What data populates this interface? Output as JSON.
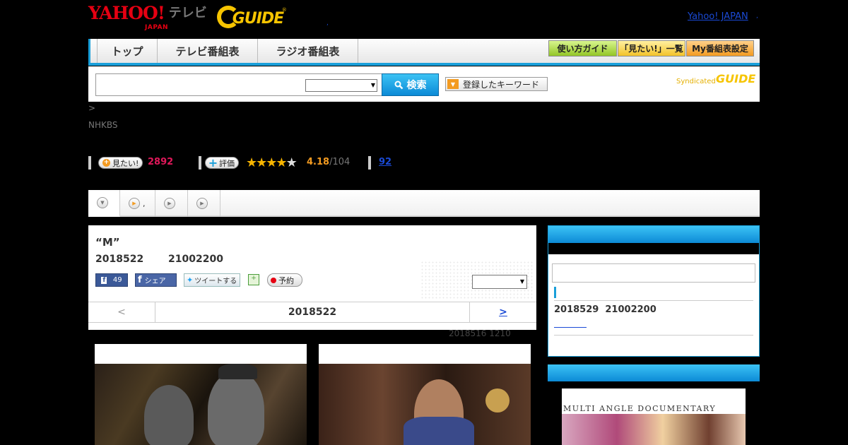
{
  "header": {
    "yahoo_logo": "YAHOO!",
    "yahoo_sub": "JAPAN",
    "tv_label": "テレビ",
    "gguide_logo": "GUIDE",
    "gguide_reg": "®",
    "dot": ",",
    "yahoo_japan_link": "Yahoo! JAPAN",
    "yahoo_japan_dot": ","
  },
  "nav": {
    "tabs": [
      {
        "label": "トップ"
      },
      {
        "label": "テレビ番組表"
      },
      {
        "label": "ラジオ番組表"
      }
    ],
    "buttons": [
      {
        "label": "使い方ガイド"
      },
      {
        "label": "「見たい!」一覧"
      },
      {
        "label": "My番組表設定"
      }
    ]
  },
  "search": {
    "query_value": "",
    "select_value": "",
    "button_label": "検索",
    "keyword_button_label": "登録したキーワード",
    "syndicated_label": "Syndicated",
    "syndicated_logo": "GUIDE"
  },
  "breadcrumb": ">",
  "channel": "NHKBS",
  "stats": {
    "mitai_label": "見たい!",
    "mitai_count": "2892",
    "rating_label": "評価",
    "rating_value": "4.18",
    "rating_total": "/104",
    "rating_stars": 4.18,
    "reviews_link": "92"
  },
  "tabs": [
    {
      "label": ""
    },
    {
      "label": ","
    },
    {
      "label": ""
    },
    {
      "label": ""
    }
  ],
  "program": {
    "title": "“M”",
    "date": "2018522",
    "time": "21002200",
    "fb_count": "49",
    "fb_share_label": "シェア",
    "tweet_label": "ツイートする",
    "reserve_label": "予約",
    "select_value": "",
    "pager_prev": "<",
    "pager_current": "2018522",
    "pager_next": ">"
  },
  "update_note": "2018516  1210",
  "sidebar": {
    "next_date": "2018529",
    "next_time": "21002200",
    "ad_text": "MULTI ANGLE DOCUMENTARY"
  },
  "colors": {
    "accent": "#1a9fd9",
    "yahoo_red": "#e60012",
    "gguide_yellow": "#f6c400",
    "mitai_count": "#e0185a",
    "rating": "#f39b21"
  }
}
